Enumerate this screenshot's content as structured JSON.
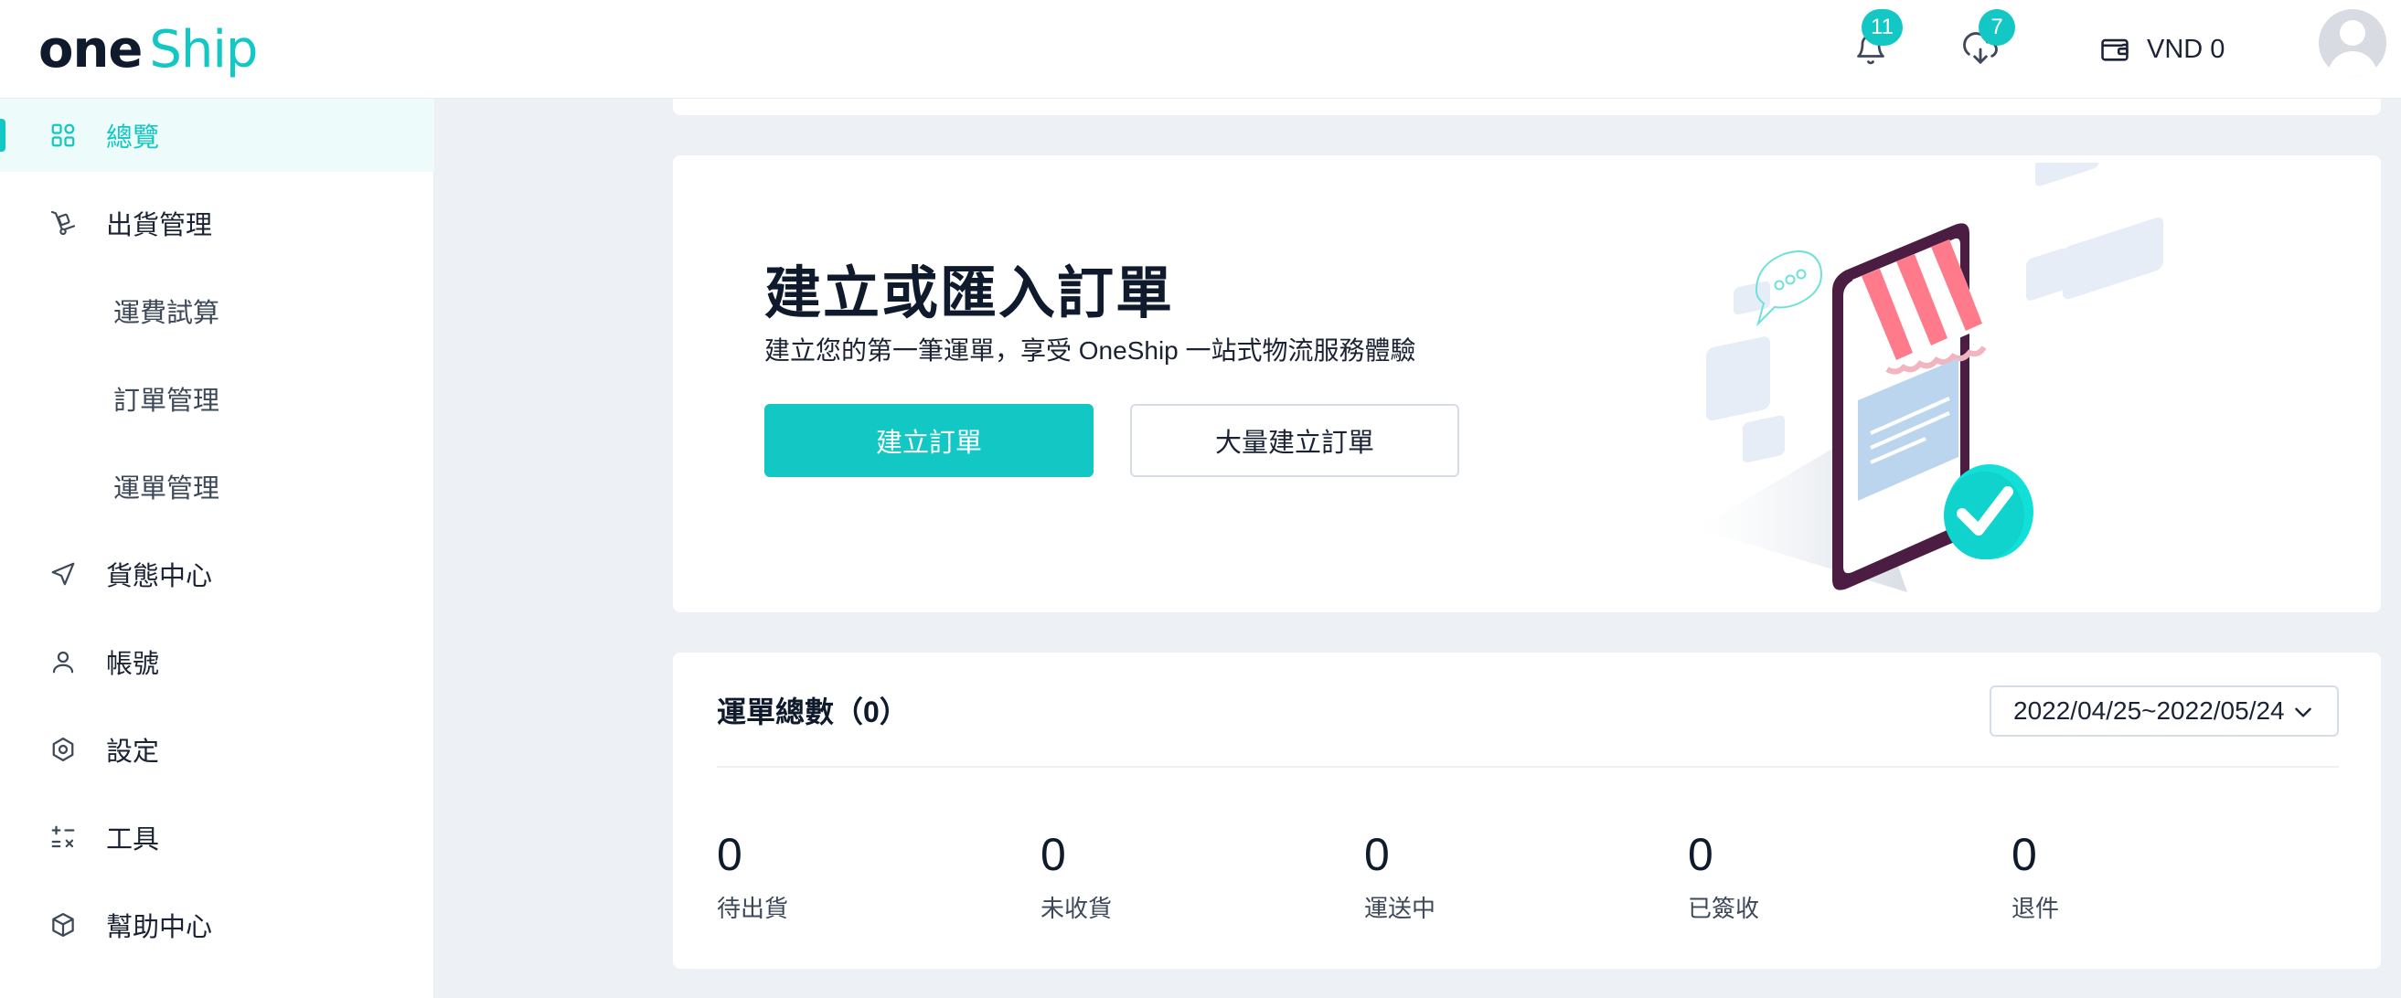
{
  "header": {
    "logo": {
      "one": "one",
      "ship": "Ship"
    },
    "notifications": {
      "count": "11",
      "icon": "bell-icon"
    },
    "downloads": {
      "count": "7",
      "icon": "download-cloud-icon"
    },
    "wallet": {
      "icon": "wallet-icon",
      "balance": "VND 0"
    },
    "avatar": "user-avatar"
  },
  "sidebar": {
    "items": [
      {
        "label": "總覽",
        "icon": "dashboard-grid-icon",
        "active": true
      },
      {
        "label": "出貨管理",
        "icon": "hand-truck-icon"
      },
      {
        "label": "運費試算",
        "sub": true
      },
      {
        "label": "訂單管理",
        "sub": true
      },
      {
        "label": "運單管理",
        "sub": true
      },
      {
        "label": "貨態中心",
        "icon": "navigation-arrow-icon"
      },
      {
        "label": "帳號",
        "icon": "user-icon"
      },
      {
        "label": "設定",
        "icon": "settings-hexagon-icon"
      },
      {
        "label": "工具",
        "icon": "calculator-tools-icon"
      },
      {
        "label": "幫助中心",
        "icon": "box-icon"
      }
    ]
  },
  "hero": {
    "title": "建立或匯入訂單",
    "subtitle": "建立您的第一筆運單，享受 OneShip 一站式物流服務體驗",
    "primary_button": "建立訂單",
    "secondary_button": "大量建立訂單"
  },
  "stats": {
    "title": "運單總數（0）",
    "date_range": "2022/04/25~2022/05/24",
    "items": [
      {
        "value": "0",
        "label": "待出貨"
      },
      {
        "value": "0",
        "label": "未收貨"
      },
      {
        "value": "0",
        "label": "運送中"
      },
      {
        "value": "0",
        "label": "已簽收"
      },
      {
        "value": "0",
        "label": "退件"
      }
    ]
  },
  "colors": {
    "accent": "#12c7c4",
    "background": "#edf0f4",
    "text": "#1a2233"
  }
}
